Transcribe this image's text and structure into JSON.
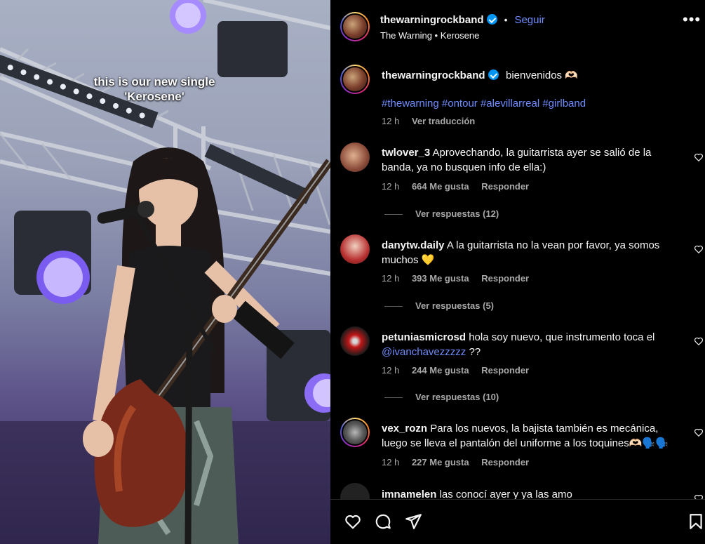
{
  "media": {
    "caption_line1": "this is our new single",
    "caption_line2": "'Kerosene'"
  },
  "header": {
    "username": "thewarningrockband",
    "separator": "•",
    "follow_label": "Seguir",
    "subtitle": "The Warning • Kerosene",
    "more_label": "•••"
  },
  "post": {
    "username": "thewarningrockband",
    "text": "bienvenidos 🫶🏻",
    "hashtags": [
      "#thewarning",
      "#ontour",
      "#alevillarreal",
      "#girlband"
    ],
    "time": "12 h",
    "translate_label": "Ver traducción"
  },
  "comments": [
    {
      "username": "twlover_3",
      "text": "Aprovechando, la guitarrista ayer se salió de la banda, ya no busquen info de ella:)",
      "time": "12 h",
      "likes": "664 Me gusta",
      "reply_label": "Responder",
      "view_replies": "Ver respuestas (12)"
    },
    {
      "username": "danytw.daily",
      "text": "A la guitarrista no la vean por favor, ya somos muchos 💛",
      "time": "12 h",
      "likes": "393 Me gusta",
      "reply_label": "Responder",
      "view_replies": "Ver respuestas (5)"
    },
    {
      "username": "petuniasmicrosd",
      "text_before": "hola soy nuevo, que instrumento toca el",
      "mention": "@ivanchavezzzzz",
      "text_after": "??",
      "time": "12 h",
      "likes": "244 Me gusta",
      "reply_label": "Responder",
      "view_replies": "Ver respuestas (10)"
    },
    {
      "username": "vex_rozn",
      "text": "Para los nuevos, la bajista también es mecánica, luego se lleva el pantalón del uniforme a los toquines🫶🏻🗣️🗣️",
      "time": "12 h",
      "likes": "227 Me gusta",
      "reply_label": "Responder"
    },
    {
      "username": "imnamelen",
      "text": "las conocí ayer y ya las amo"
    }
  ],
  "actions": {
    "like": "heart-icon",
    "comment": "comment-icon",
    "share": "share-icon",
    "save": "bookmark-icon"
  },
  "colors": {
    "link": "#6f8cff",
    "verified": "#0095f6",
    "meta": "#a8a8a8",
    "background": "#000000"
  }
}
